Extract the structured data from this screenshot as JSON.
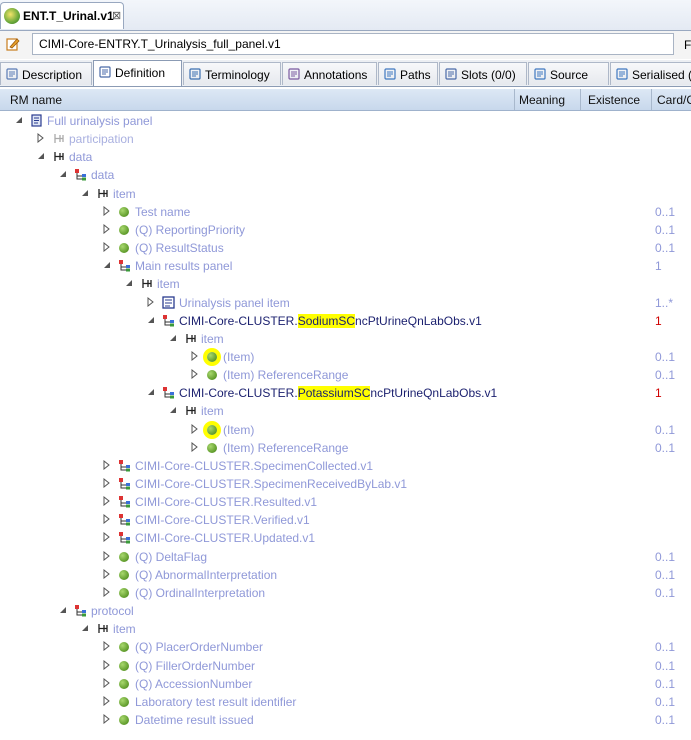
{
  "editor_tab": {
    "title": "ENT.T_Urinal.v1",
    "close": "⊠"
  },
  "archetype_id": {
    "value": "CIMI-Core-ENTRY.T_Urinalysis_full_panel.v1",
    "trailing": "Fi"
  },
  "view_tabs": [
    {
      "label": "Description",
      "icon": "description-icon"
    },
    {
      "label": "Definition",
      "icon": "definition-icon",
      "active": true
    },
    {
      "label": "Terminology",
      "icon": "terminology-icon"
    },
    {
      "label": "Annotations",
      "icon": "annotations-icon"
    },
    {
      "label": "Paths",
      "icon": "paths-icon"
    },
    {
      "label": "Slots (0/0)",
      "icon": "slots-icon"
    },
    {
      "label": "Source",
      "icon": "source-icon"
    },
    {
      "label": "Serialised (fl",
      "icon": "serialised-icon"
    }
  ],
  "columns": {
    "rm_name": "RM name",
    "meaning": "Meaning",
    "existence": "Existence",
    "cardinality": "Card/C"
  },
  "tree": [
    {
      "label": "Full urinalysis panel",
      "depth": 0,
      "twisty": "open",
      "icon": "entry-icon",
      "card": ""
    },
    {
      "label": "participation",
      "depth": 1,
      "twisty": "closed",
      "icon": "attribute-icon",
      "card": "",
      "faded": true
    },
    {
      "label": "data",
      "depth": 1,
      "twisty": "open",
      "icon": "attribute-icon",
      "card": ""
    },
    {
      "label": "data",
      "depth": 2,
      "twisty": "open",
      "icon": "cluster-icon",
      "card": ""
    },
    {
      "label": "item",
      "depth": 3,
      "twisty": "open",
      "icon": "attribute-icon",
      "card": ""
    },
    {
      "label": "Test name",
      "depth": 4,
      "twisty": "closed",
      "icon": "element-icon",
      "card": "0..1"
    },
    {
      "label": "(Q) ReportingPriority",
      "depth": 4,
      "twisty": "closed",
      "icon": "element-icon",
      "card": "0..1"
    },
    {
      "label": "(Q) ResultStatus",
      "depth": 4,
      "twisty": "closed",
      "icon": "element-icon",
      "card": "0..1"
    },
    {
      "label": "Main results panel",
      "depth": 4,
      "twisty": "open",
      "icon": "cluster-icon",
      "card": "1"
    },
    {
      "label": "item",
      "depth": 5,
      "twisty": "open",
      "icon": "attribute-icon",
      "card": ""
    },
    {
      "label": "Urinalysis panel item",
      "depth": 6,
      "twisty": "closed",
      "icon": "slot-icon",
      "card": "1..*"
    },
    {
      "label": "CIMI-Core-CLUSTER.",
      "hl": "SodiumSC",
      "rest": "ncPtUrineQnLabObs.v1",
      "dark": true,
      "depth": 6,
      "twisty": "open",
      "icon": "cluster-icon",
      "card": "1",
      "card_red": true
    },
    {
      "label": "item",
      "depth": 7,
      "twisty": "open",
      "icon": "attribute-icon",
      "card": ""
    },
    {
      "label": "(Item)",
      "depth": 8,
      "twisty": "closed",
      "icon": "element-icon",
      "card": "0..1",
      "highlight": true
    },
    {
      "label": "(Item) ReferenceRange",
      "depth": 8,
      "twisty": "closed",
      "icon": "element-icon",
      "card": "0..1"
    },
    {
      "label": "CIMI-Core-CLUSTER.",
      "hl": "PotassiumSC",
      "rest": "ncPtUrineQnLabObs.v1",
      "dark": true,
      "depth": 6,
      "twisty": "open",
      "icon": "cluster-icon",
      "card": "1",
      "card_red": true
    },
    {
      "label": "item",
      "depth": 7,
      "twisty": "open",
      "icon": "attribute-icon",
      "card": ""
    },
    {
      "label": "(Item)",
      "depth": 8,
      "twisty": "closed",
      "icon": "element-icon",
      "card": "0..1",
      "highlight": true
    },
    {
      "label": "(Item) ReferenceRange",
      "depth": 8,
      "twisty": "closed",
      "icon": "element-icon",
      "card": "0..1"
    },
    {
      "label": "CIMI-Core-CLUSTER.SpecimenCollected.v1",
      "depth": 4,
      "twisty": "closed",
      "icon": "cluster-icon",
      "card": ""
    },
    {
      "label": "CIMI-Core-CLUSTER.SpecimenReceivedByLab.v1",
      "depth": 4,
      "twisty": "closed",
      "icon": "cluster-icon",
      "card": ""
    },
    {
      "label": "CIMI-Core-CLUSTER.Resulted.v1",
      "depth": 4,
      "twisty": "closed",
      "icon": "cluster-icon",
      "card": ""
    },
    {
      "label": "CIMI-Core-CLUSTER.Verified.v1",
      "depth": 4,
      "twisty": "closed",
      "icon": "cluster-icon",
      "card": ""
    },
    {
      "label": "CIMI-Core-CLUSTER.Updated.v1",
      "depth": 4,
      "twisty": "closed",
      "icon": "cluster-icon",
      "card": ""
    },
    {
      "label": "(Q) DeltaFlag",
      "depth": 4,
      "twisty": "closed",
      "icon": "element-icon",
      "card": "0..1"
    },
    {
      "label": "(Q) AbnormalInterpretation",
      "depth": 4,
      "twisty": "closed",
      "icon": "element-icon",
      "card": "0..1"
    },
    {
      "label": "(Q) OrdinalInterpretation",
      "depth": 4,
      "twisty": "closed",
      "icon": "element-icon",
      "card": "0..1"
    },
    {
      "label": "protocol",
      "depth": 2,
      "twisty": "open",
      "icon": "cluster-icon",
      "card": ""
    },
    {
      "label": "item",
      "depth": 3,
      "twisty": "open",
      "icon": "attribute-icon",
      "card": ""
    },
    {
      "label": "(Q) PlacerOrderNumber",
      "depth": 4,
      "twisty": "closed",
      "icon": "element-icon",
      "card": "0..1"
    },
    {
      "label": "(Q) FillerOrderNumber",
      "depth": 4,
      "twisty": "closed",
      "icon": "element-icon",
      "card": "0..1"
    },
    {
      "label": "(Q) AccessionNumber",
      "depth": 4,
      "twisty": "closed",
      "icon": "element-icon",
      "card": "0..1"
    },
    {
      "label": "Laboratory test result identifier",
      "depth": 4,
      "twisty": "closed",
      "icon": "element-icon",
      "card": "0..1"
    },
    {
      "label": "Datetime result issued",
      "depth": 4,
      "twisty": "closed",
      "icon": "element-icon",
      "card": "0..1"
    }
  ]
}
